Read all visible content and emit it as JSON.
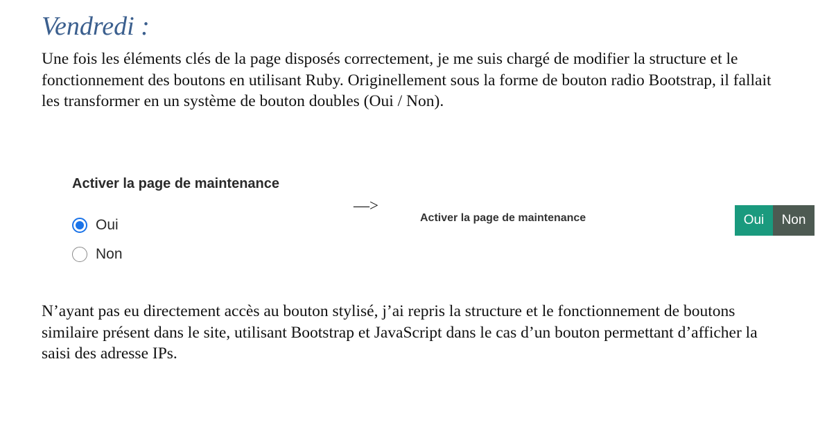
{
  "heading": "Vendredi :",
  "paragraph1": "Une fois les éléments clés de la page disposés correctement, je me suis chargé de modifier la structure et le fonctionnement des boutons en utilisant Ruby. Originellement sous la forme de bouton radio Bootstrap, il fallait les transformer en un système de bouton doubles (Oui / Non).",
  "before_widget": {
    "title": "Activer la page de maintenance",
    "options": [
      {
        "label": "Oui",
        "checked": true
      },
      {
        "label": "Non",
        "checked": false
      }
    ],
    "accent_color": "#1a73e8"
  },
  "arrow": "—>",
  "after_widget": {
    "title": "Activer la page de maintenance",
    "yes_label": "Oui",
    "no_label": "Non",
    "yes_color": "#1a9a7e",
    "no_color": "#4d5a52"
  },
  "paragraph2": "N’ayant pas eu directement accès au bouton stylisé, j’ai repris la structure et le fonctionnement de boutons similaire présent dans le site, utilisant Bootstrap et JavaScript dans le cas d’un bouton permettant d’afficher la saisi des adresse IPs."
}
